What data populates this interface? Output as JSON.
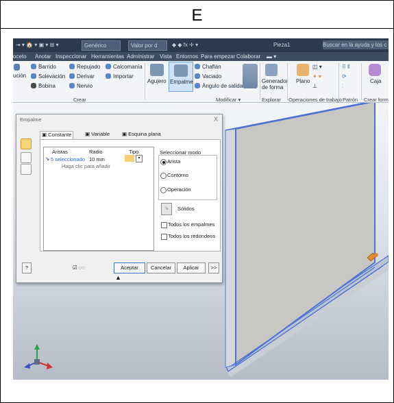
{
  "figure_letter": "E",
  "titlebar": {
    "material": "Genérico",
    "value_field": "Valor por d",
    "doc_name": "Pieza1",
    "help_search": "Buscar en la ayuda y los c"
  },
  "menu_tabs": [
    "oceto",
    "Anotar",
    "Inspeccionar",
    "Herramientas",
    "Administrar",
    "Vista",
    "Entornos",
    "Para empezar",
    "Colaborar"
  ],
  "ribbon": {
    "crear": {
      "extrusion_partial": "ución",
      "items": [
        "Barrido",
        "Repujado",
        "Calcomanía",
        "Solevación",
        "Derivar",
        "Importar",
        "Bobina",
        "Nervio"
      ],
      "group_label": "Crear"
    },
    "modificar": {
      "large": [
        "Agujero",
        "Empalme"
      ],
      "items": [
        "Chaflán",
        "Vaciado",
        "Ángulo de salida"
      ],
      "group_label": "Modificar ▾"
    },
    "explorar": {
      "large": "Generador de forma",
      "group_label": "Explorar"
    },
    "trabajo": {
      "large": "Plano",
      "group_label": "Operaciones de trabajo"
    },
    "patron": {
      "group_label": "Patrón"
    },
    "crearform": {
      "large": "Caja",
      "group_label": "Crear form"
    }
  },
  "dialog": {
    "title": "Empalme",
    "close": "X",
    "tabs": [
      "Constante",
      "Variable",
      "Esquina plana"
    ],
    "columns": {
      "edges": "Aristas",
      "radius": "Radio",
      "type": "Tipo"
    },
    "row": {
      "edges": "5 seleccionado",
      "radius": "10 mm"
    },
    "add_hint": "Haga clic para añadir",
    "select_mode": {
      "label": "Seleccionar modo",
      "options": [
        "Arista",
        "Contorno",
        "Operación"
      ],
      "selected": "Arista"
    },
    "solids_label": "Sólidos",
    "checks": [
      "Todos los empalmes",
      "Todos los redondeos"
    ],
    "buttons": {
      "ok": "Aceptar",
      "cancel": "Cancelar",
      "apply": "Aplicar",
      "more": ">>"
    }
  },
  "colors": {
    "accent": "#3a78c9",
    "ribbon_dark": "#2b3a4d",
    "panel_gray": "#c9c9c9"
  }
}
